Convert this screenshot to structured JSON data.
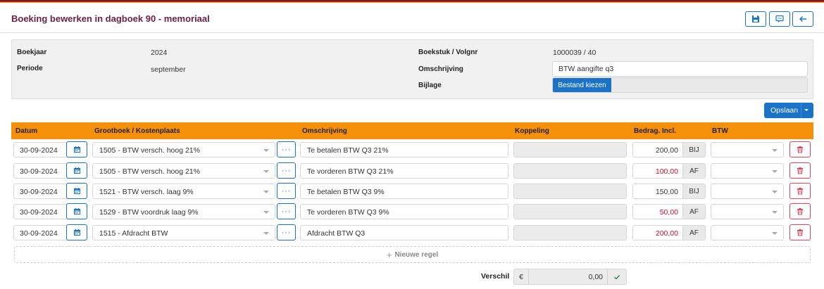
{
  "header": {
    "title": "Boeking bewerken in dagboek 90 - memoriaal"
  },
  "info": {
    "boekjaar_label": "Boekjaar",
    "boekjaar_value": "2024",
    "periode_label": "Periode",
    "periode_value": "september",
    "boekstuk_label": "Boekstuk / Volgnr",
    "boekstuk_value": "1000039 / 40",
    "omschrijving_label": "Omschrijving",
    "omschrijving_value": "BTW aangifte q3",
    "bijlage_label": "Bijlage",
    "bijlage_button": "Bestand kiezen"
  },
  "save_button": "Opslaan",
  "table": {
    "headers": {
      "datum": "Datum",
      "grootboek": "Grootboek / Kostenplaats",
      "omschrijving": "Omschrijving",
      "koppeling": "Koppeling",
      "bedrag": "Bedrag. Incl.",
      "btw": "BTW"
    },
    "more_label": "···",
    "rows": [
      {
        "datum": "30-09-2024",
        "grootboek": "1505 - BTW versch. hoog 21%",
        "omschrijving": "Te betalen BTW Q3 21%",
        "bedrag": "200,00",
        "richting": "BIJ"
      },
      {
        "datum": "30-09-2024",
        "grootboek": "1505 - BTW versch. hoog 21%",
        "omschrijving": "Te vorderen BTW Q3 21%",
        "bedrag": "100,00",
        "richting": "AF"
      },
      {
        "datum": "30-09-2024",
        "grootboek": "1521 - BTW versch. laag 9%",
        "omschrijving": "Te betalen BTW Q3 9%",
        "bedrag": "150,00",
        "richting": "BIJ"
      },
      {
        "datum": "30-09-2024",
        "grootboek": "1529 - BTW voordruk laag 9%",
        "omschrijving": "Te vorderen BTW Q3 9%",
        "bedrag": "50,00",
        "richting": "AF"
      },
      {
        "datum": "30-09-2024",
        "grootboek": "1515 - Afdracht BTW",
        "omschrijving": "Afdracht BTW Q3",
        "bedrag": "200,00",
        "richting": "AF"
      }
    ]
  },
  "new_row_label": "Nieuwe regel",
  "verschil": {
    "label": "Verschil",
    "currency": "€",
    "value": "0,00"
  },
  "colors": {
    "accent": "#1a73c8",
    "header_bar": "#f5900a",
    "title": "#6b1e46",
    "negative": "#c8102e"
  }
}
